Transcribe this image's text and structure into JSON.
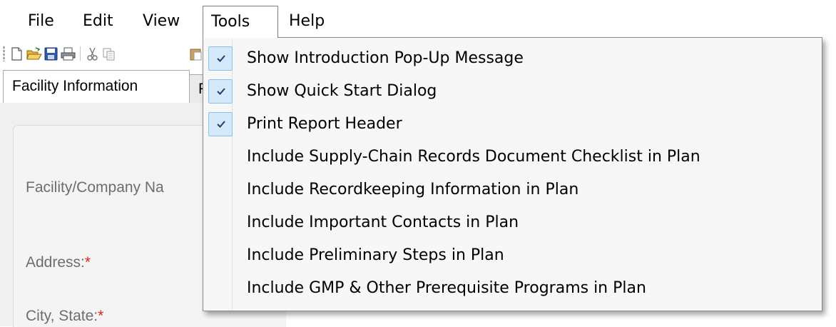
{
  "menubar": {
    "items": [
      "File",
      "Edit",
      "View",
      "Tools",
      "Help"
    ],
    "open_menu": "Tools"
  },
  "toolbar": {
    "icons": [
      "new-icon",
      "open-icon",
      "save-icon",
      "print-icon",
      "cut-icon",
      "copy-icon",
      "paste-icon"
    ]
  },
  "tabs": {
    "active": "Facility Information",
    "partial": "P"
  },
  "form": {
    "labels": [
      "Facility/Company Na",
      "Address:",
      "City, State:"
    ],
    "required_marker": "*"
  },
  "tools_menu": {
    "items": [
      {
        "label": "Show Introduction Pop-Up Message",
        "checked": true
      },
      {
        "label": "Show Quick Start Dialog",
        "checked": true
      },
      {
        "label": "Print Report Header",
        "checked": true
      },
      {
        "label": "Include Supply-Chain Records Document Checklist in Plan",
        "checked": false
      },
      {
        "label": "Include Recordkeeping Information in Plan",
        "checked": false
      },
      {
        "label": "Include Important Contacts in Plan",
        "checked": false
      },
      {
        "label": "Include Preliminary Steps in Plan",
        "checked": false
      },
      {
        "label": "Include GMP & Other Prerequisite Programs in Plan",
        "checked": false
      }
    ]
  },
  "colors": {
    "required": "#e0251b",
    "check_bg": "#d5e9fa",
    "check_border": "#8bc1ec",
    "check_mark": "#1f3f6b"
  }
}
